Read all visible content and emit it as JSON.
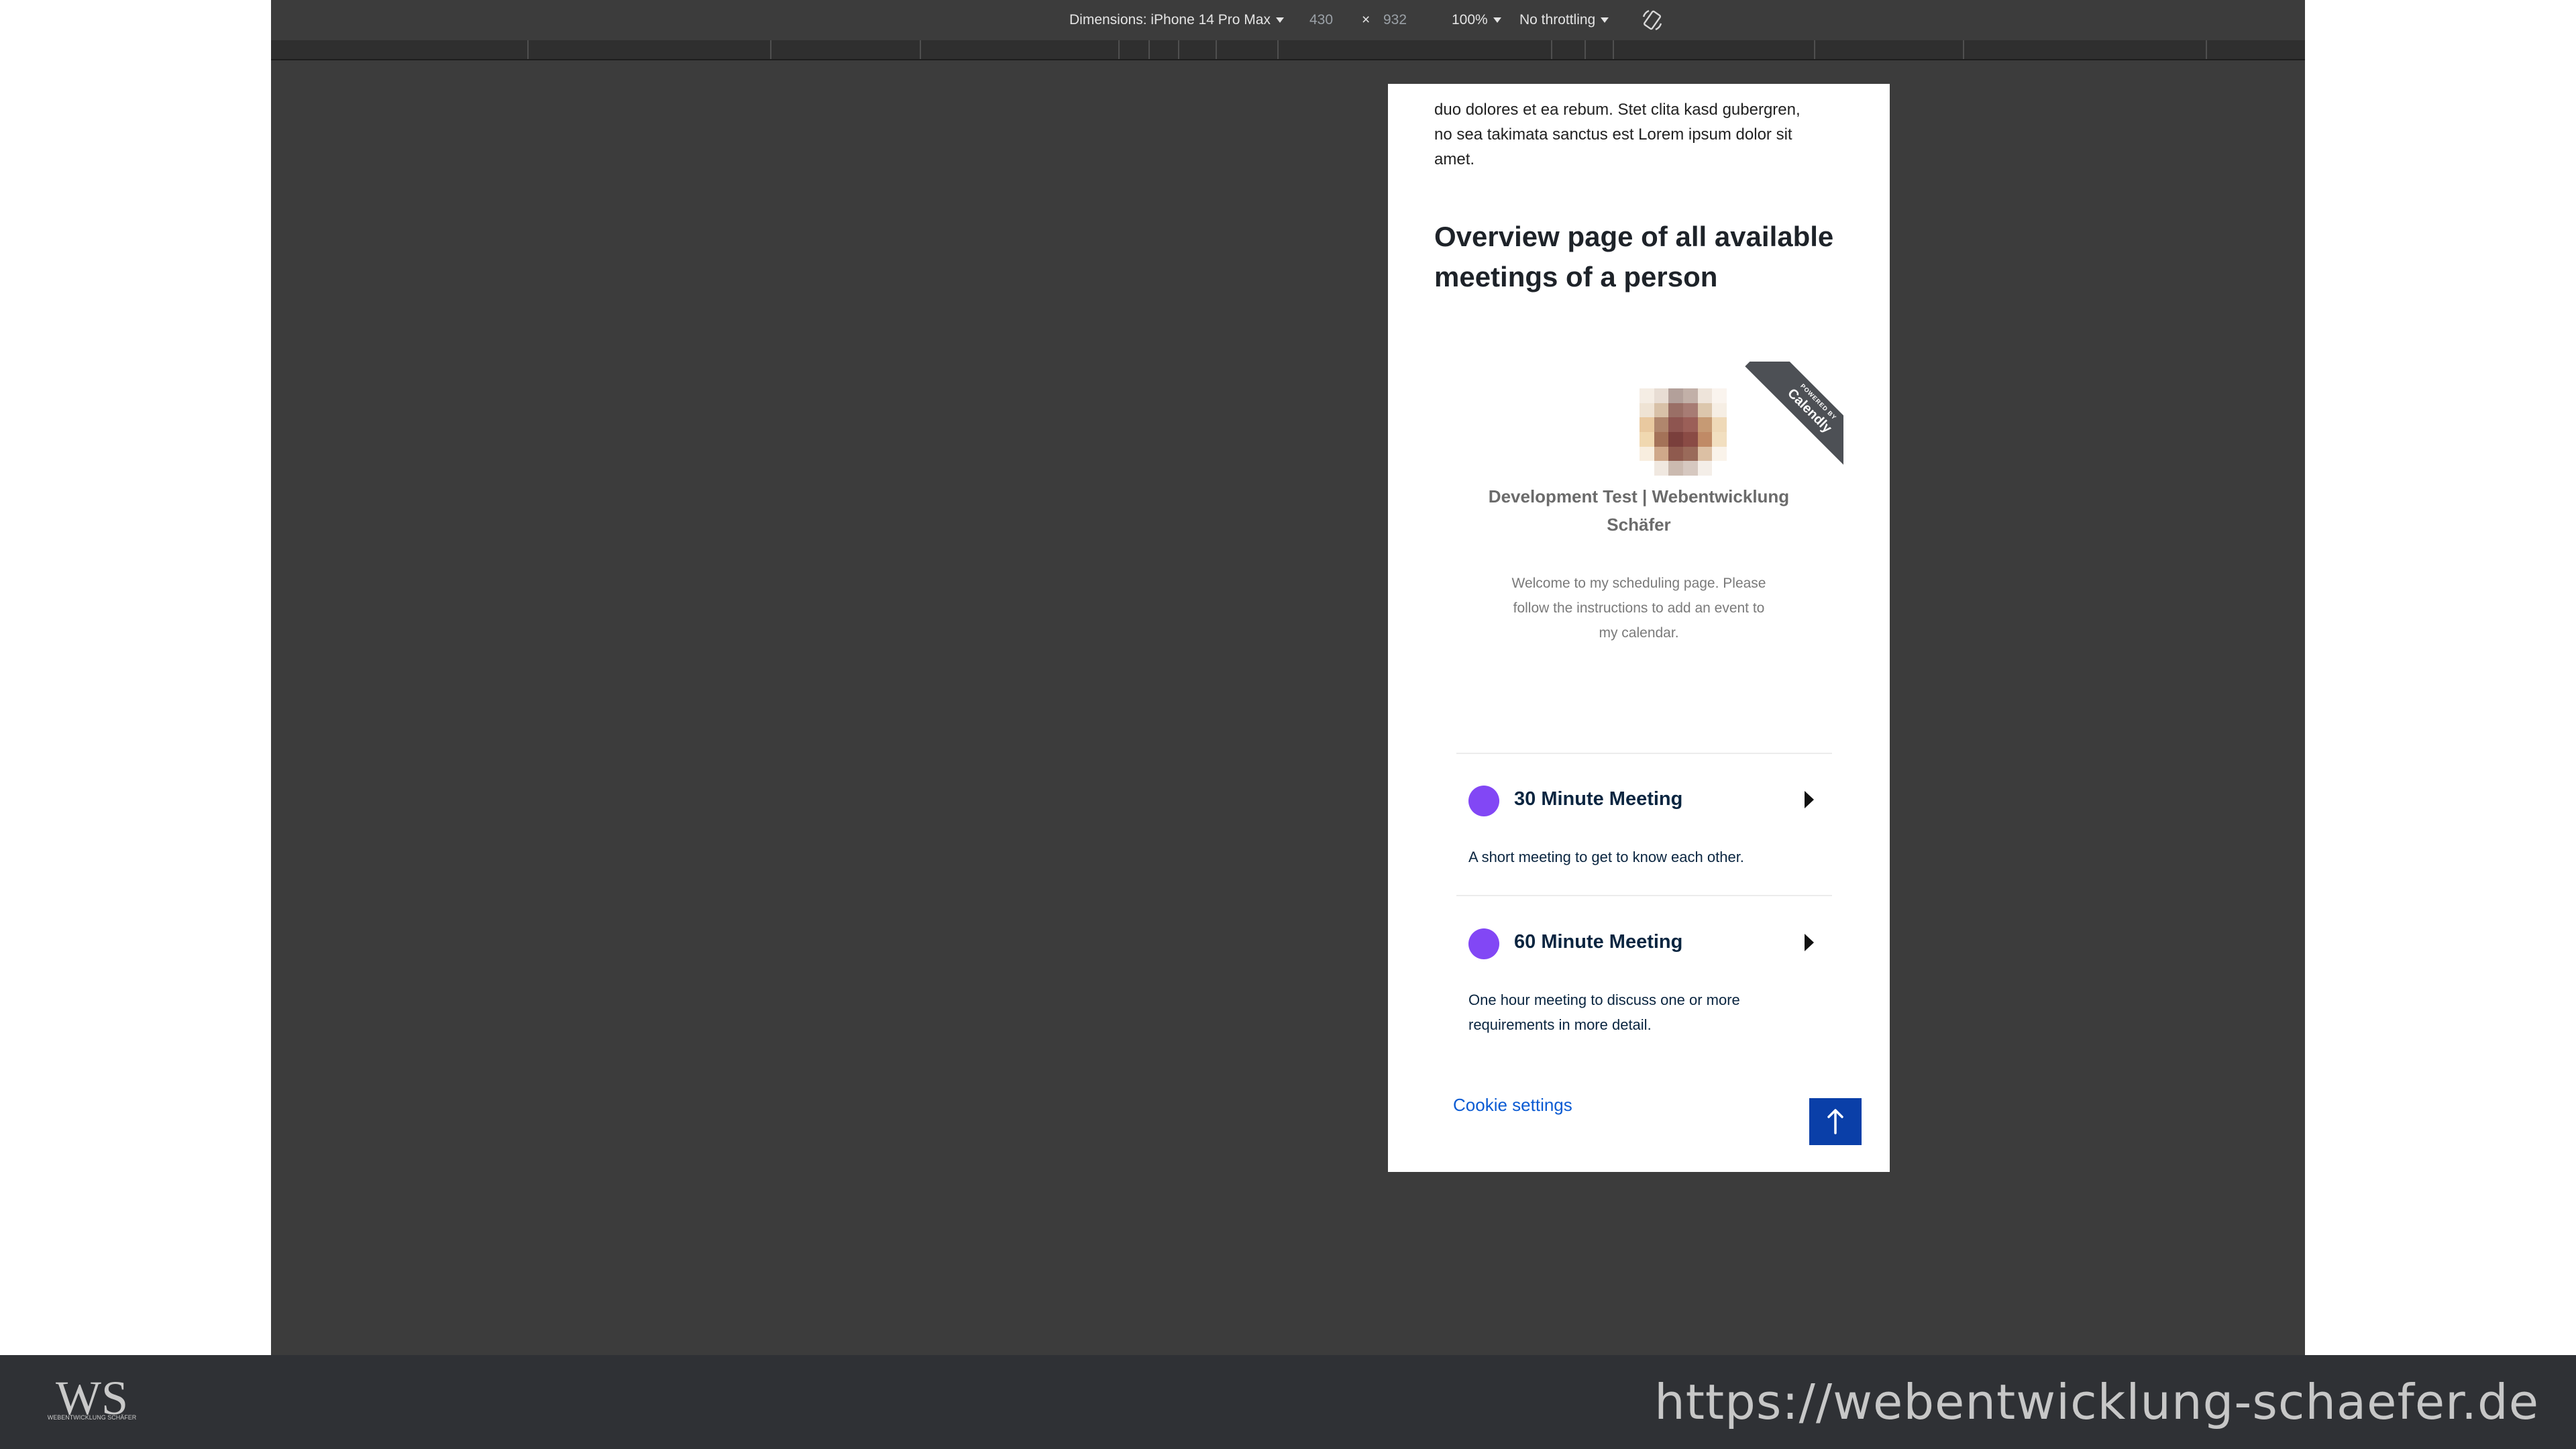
{
  "devtools": {
    "dimensions_label": "Dimensions: iPhone 14 Pro Max",
    "width": "430",
    "times": "×",
    "height": "932",
    "zoom": "100%",
    "throttling": "No throttling",
    "rotate_icon": "rotate-icon"
  },
  "page": {
    "intro_line1": "duo dolores et ea rebum. Stet clita kasd gubergren,",
    "intro_line2": "no sea takimata sanctus est Lorem ipsum dolor sit",
    "intro_line3": "amet.",
    "title": "Overview page of all available meetings of a person"
  },
  "calendly": {
    "ribbon_top": "POWERED BY",
    "ribbon_brand": "Calendly",
    "org_name": "Development Test | Webentwicklung Schäfer",
    "welcome": "Welcome to my scheduling page. Please follow the instructions to add an event to my calendar.",
    "events": [
      {
        "title": "30 Minute Meeting",
        "description": "A short meeting to get to know each other.",
        "color": "#8247f5"
      },
      {
        "title": "60 Minute Meeting",
        "description": "One hour meeting to discuss one or more requirements in more detail.",
        "color": "#8247f5"
      }
    ]
  },
  "footer": {
    "cookie_settings": "Cookie settings",
    "back_to_top_icon": "arrow-up-icon"
  },
  "branding": {
    "logo_letters": "WS",
    "logo_sub": "WEBENTWICKLUNG SCHÄFER",
    "url": "https://webentwicklung-schaefer.de"
  },
  "colors": {
    "devtools_bg": "#3c3c3c",
    "event_dot": "#8247f5",
    "link": "#0b5bd3",
    "back_to_top": "#0a3fa8",
    "brand_bar": "#2f3135"
  }
}
